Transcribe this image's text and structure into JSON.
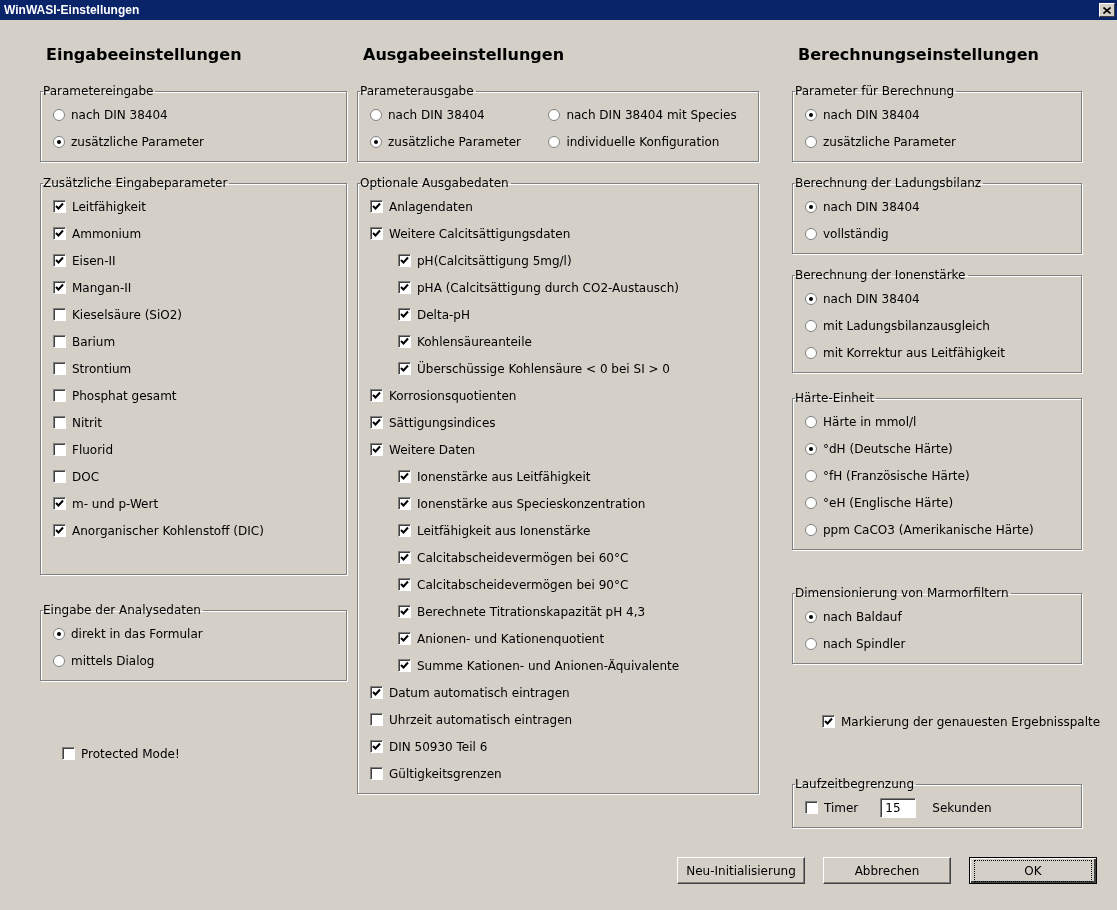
{
  "window": {
    "title": "WinWASI-Einstellungen"
  },
  "columns": [
    {
      "heading": "Eingabeeinstellungen",
      "items": [
        {
          "kind": "group",
          "label": "Parametereingabe",
          "options": [
            {
              "kind": "radio",
              "label": "nach DIN 38404",
              "selected": false
            },
            {
              "kind": "radio",
              "label": "zusätzliche Parameter",
              "selected": true
            }
          ]
        },
        {
          "kind": "group",
          "label": "Zusätzliche Eingabeparameter",
          "options": [
            {
              "kind": "checkbox",
              "label": "Leitfähigkeit",
              "checked": true
            },
            {
              "kind": "checkbox",
              "label": "Ammonium",
              "checked": true
            },
            {
              "kind": "checkbox",
              "label": "Eisen-II",
              "checked": true
            },
            {
              "kind": "checkbox",
              "label": "Mangan-II",
              "checked": true
            },
            {
              "kind": "checkbox",
              "label": "Kieselsäure (SiO2)",
              "checked": false
            },
            {
              "kind": "checkbox",
              "label": "Barium",
              "checked": false
            },
            {
              "kind": "checkbox",
              "label": "Strontium",
              "checked": false
            },
            {
              "kind": "checkbox",
              "label": "Phosphat gesamt",
              "checked": false
            },
            {
              "kind": "checkbox",
              "label": "Nitrit",
              "checked": false
            },
            {
              "kind": "checkbox",
              "label": "Fluorid",
              "checked": false
            },
            {
              "kind": "checkbox",
              "label": "DOC",
              "checked": false
            },
            {
              "kind": "checkbox",
              "label": "m- und p-Wert",
              "checked": true
            },
            {
              "kind": "checkbox",
              "label": "Anorganischer Kohlenstoff (DIC)",
              "checked": true
            }
          ]
        },
        {
          "kind": "group",
          "label": "Eingabe der Analysedaten",
          "options": [
            {
              "kind": "radio",
              "label": "direkt in das Formular",
              "selected": true
            },
            {
              "kind": "radio",
              "label": "mittels Dialog",
              "selected": false
            }
          ]
        },
        {
          "kind": "checkbox",
          "label": "Protected Mode!",
          "checked": false
        }
      ]
    },
    {
      "heading": "Ausgabeeinstellungen",
      "items": [
        {
          "kind": "grid",
          "label": "Parameterausgabe",
          "rows": [
            [
              {
                "kind": "radio",
                "label": "nach DIN 38404",
                "selected": false
              },
              {
                "kind": "radio",
                "label": "nach DIN 38404 mit Species",
                "selected": false
              }
            ],
            [
              {
                "kind": "radio",
                "label": "zusätzliche Parameter",
                "selected": true
              },
              {
                "kind": "radio",
                "label": "individuelle Konfiguration",
                "selected": false
              }
            ]
          ]
        },
        {
          "kind": "group",
          "label": "Optionale Ausgabedaten",
          "options": [
            {
              "kind": "checkbox",
              "label": "Anlagendaten",
              "checked": true
            },
            {
              "kind": "checkbox",
              "label": "Weitere Calcitsättigungsdaten",
              "checked": true,
              "children": [
                {
                  "kind": "checkbox",
                  "label": "pH(Calcitsättigung 5mg/l)",
                  "checked": true
                },
                {
                  "kind": "checkbox",
                  "label": "pHA (Calcitsättigung durch CO2-Austausch)",
                  "checked": true
                },
                {
                  "kind": "checkbox",
                  "label": "Delta-pH",
                  "checked": true
                },
                {
                  "kind": "checkbox",
                  "label": "Kohlensäureanteile",
                  "checked": true
                },
                {
                  "kind": "checkbox",
                  "label": "Überschüssige Kohlensäure < 0 bei SI > 0",
                  "checked": true
                }
              ]
            },
            {
              "kind": "checkbox",
              "label": "Korrosionsquotienten",
              "checked": true
            },
            {
              "kind": "checkbox",
              "label": "Sättigungsindices",
              "checked": true
            },
            {
              "kind": "checkbox",
              "label": "Weitere Daten",
              "checked": true,
              "children": [
                {
                  "kind": "checkbox",
                  "label": "Ionenstärke aus Leitfähigkeit",
                  "checked": true
                },
                {
                  "kind": "checkbox",
                  "label": "Ionenstärke aus Specieskonzentration",
                  "checked": true
                },
                {
                  "kind": "checkbox",
                  "label": "Leitfähigkeit aus Ionenstärke",
                  "checked": true
                },
                {
                  "kind": "checkbox",
                  "label": "Calcitabscheidevermögen bei 60°C",
                  "checked": true
                },
                {
                  "kind": "checkbox",
                  "label": "Calcitabscheidevermögen bei 90°C",
                  "checked": true
                },
                {
                  "kind": "checkbox",
                  "label": "Berechnete Titrationskapazität pH 4,3",
                  "checked": true
                },
                {
                  "kind": "checkbox",
                  "label": "Anionen- und Kationenquotient",
                  "checked": true
                },
                {
                  "kind": "checkbox",
                  "label": "Summe Kationen- und Anionen-Äquivalente",
                  "checked": true
                }
              ]
            },
            {
              "kind": "checkbox",
              "label": "Datum automatisch eintragen",
              "checked": true
            },
            {
              "kind": "checkbox",
              "label": "Uhrzeit automatisch eintragen",
              "checked": false
            },
            {
              "kind": "checkbox",
              "label": "DIN 50930 Teil 6",
              "checked": true
            },
            {
              "kind": "checkbox",
              "label": "Gültigkeitsgrenzen",
              "checked": false
            }
          ]
        }
      ]
    },
    {
      "heading": "Berechnungseinstellungen",
      "items": [
        {
          "kind": "group",
          "label": "Parameter für Berechnung",
          "options": [
            {
              "kind": "radio",
              "label": "nach DIN 38404",
              "selected": true
            },
            {
              "kind": "radio",
              "label": "zusätzliche Parameter",
              "selected": false
            }
          ]
        },
        {
          "kind": "group",
          "label": "Berechnung der Ladungsbilanz",
          "options": [
            {
              "kind": "radio",
              "label": "nach DIN 38404",
              "selected": true
            },
            {
              "kind": "radio",
              "label": "vollständig",
              "selected": false
            }
          ]
        },
        {
          "kind": "group",
          "label": "Berechnung der Ionenstärke",
          "options": [
            {
              "kind": "radio",
              "label": "nach DIN 38404",
              "selected": true
            },
            {
              "kind": "radio",
              "label": "mit Ladungsbilanzausgleich",
              "selected": false
            },
            {
              "kind": "radio",
              "label": "mit Korrektur aus Leitfähigkeit",
              "selected": false
            }
          ]
        },
        {
          "kind": "group",
          "label": "Härte-Einheit",
          "options": [
            {
              "kind": "radio",
              "label": "Härte in mmol/l",
              "selected": false
            },
            {
              "kind": "radio",
              "label": "°dH (Deutsche Härte)",
              "selected": true
            },
            {
              "kind": "radio",
              "label": "°fH (Französische Härte)",
              "selected": false
            },
            {
              "kind": "radio",
              "label": "°eH (Englische Härte)",
              "selected": false
            },
            {
              "kind": "radio",
              "label": "ppm CaCO3 (Amerikanische Härte)",
              "selected": false
            }
          ]
        },
        {
          "kind": "group",
          "label": "Dimensionierung von Marmorfiltern",
          "options": [
            {
              "kind": "radio",
              "label": "nach Baldauf",
              "selected": true
            },
            {
              "kind": "radio",
              "label": "nach Spindler",
              "selected": false
            }
          ]
        },
        {
          "kind": "checkbox",
          "label": "Markierung der genauesten Ergebnisspalte",
          "checked": true
        },
        {
          "kind": "group",
          "label": "Laufzeitbegrenzung",
          "options": [
            {
              "kind": "timer",
              "label": "Timer",
              "checked": false,
              "value": "15",
              "unit": "Sekunden"
            }
          ]
        }
      ]
    }
  ],
  "buttons": [
    {
      "label": "Neu-Initialisierung",
      "default": false
    },
    {
      "label": "Abbrechen",
      "default": false
    },
    {
      "label": "OK",
      "default": true
    }
  ]
}
